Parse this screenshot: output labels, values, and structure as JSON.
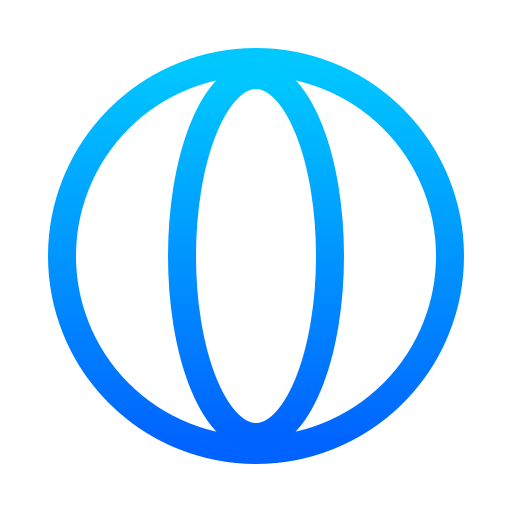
{
  "icon": {
    "name": "globe-icon",
    "gradient_top": "#00C8FF",
    "gradient_bottom": "#0062FF",
    "background": "#FFFFFF"
  }
}
